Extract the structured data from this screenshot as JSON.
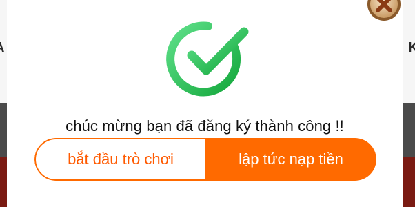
{
  "background": {
    "left_letter": "A",
    "right_letter": "K"
  },
  "dialog": {
    "message": "chúc mừng bạn đã đăng ký thành công !!",
    "buttons": {
      "start_game_label": "bắt đầu trò chơi",
      "top_up_label": "lập tức nạp tiền"
    },
    "icons": {
      "success": "check-circle-icon",
      "close": "close-icon"
    },
    "colors": {
      "accent": "#ff6a00",
      "success_green": "#2bc25a"
    }
  }
}
